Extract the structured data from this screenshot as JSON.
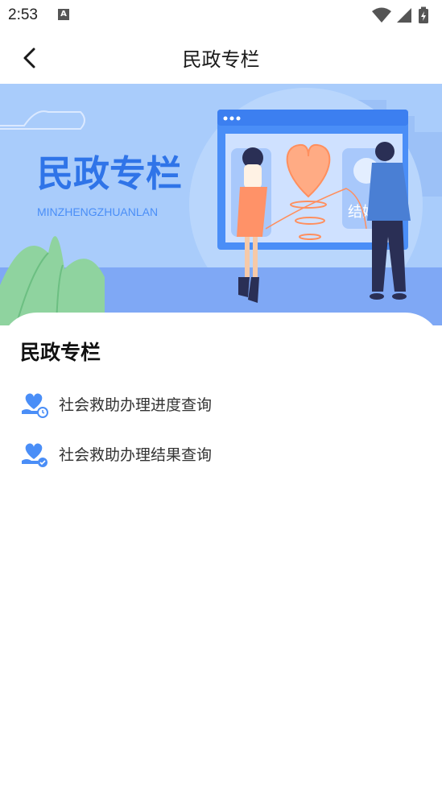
{
  "status_bar": {
    "time": "2:53",
    "notification_icon_letter": "A",
    "icons": [
      "wifi-icon",
      "signal-icon",
      "battery-charging-icon"
    ]
  },
  "header": {
    "title": "民政专栏",
    "back_icon": "chevron-left-icon"
  },
  "banner": {
    "title": "民政专栏",
    "subtitle": "MINZHENGZHUANLAN",
    "screen_label": "结婚",
    "colors": {
      "sky": "#a9ccfb",
      "title": "#2f74e8",
      "ground": "#7fa8f5"
    }
  },
  "section": {
    "title": "民政专栏",
    "items": [
      {
        "label": "社会救助办理进度查询",
        "icon": "heart-hand-clock-icon"
      },
      {
        "label": "社会救助办理结果查询",
        "icon": "heart-hand-check-icon"
      }
    ]
  },
  "colors": {
    "accent": "#4a8ef7"
  }
}
